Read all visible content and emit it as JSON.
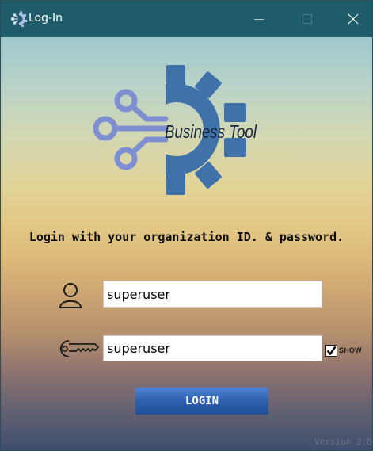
{
  "window": {
    "title": "Log-In",
    "title_icon": "gear-network-icon",
    "controls": {
      "minimize_icon": "minimize-icon",
      "maximize_icon": "maximize-icon",
      "close_icon": "close-icon"
    }
  },
  "logo": {
    "text": "Business Tool",
    "icon": "gear-network-icon",
    "colors": {
      "gear": "#3f72a9",
      "hubs": "#7d8fd0"
    }
  },
  "headline": "Login with your organization ID. & password.",
  "form": {
    "username": {
      "icon": "user-icon",
      "value": "superuser"
    },
    "password": {
      "icon": "key-icon",
      "value": "superuser",
      "show_checked": true,
      "show_label": "SHOW"
    },
    "login_label": "LOGIN"
  },
  "version_text": "Version 2.0",
  "colors": {
    "titlebar": "#1f5c69",
    "login_button": "#2f63b2"
  }
}
